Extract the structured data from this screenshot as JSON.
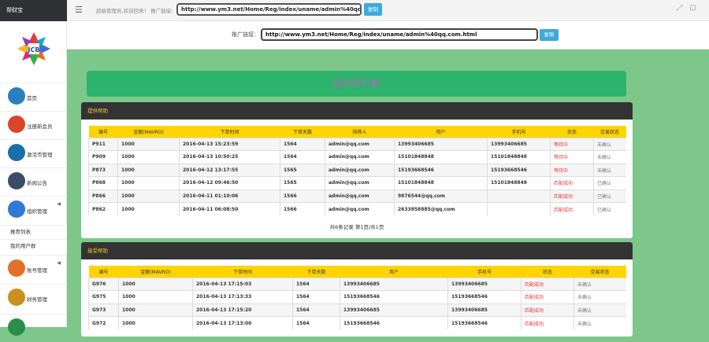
{
  "brand": "帮财宝",
  "menu_icon": "hamburger-icon",
  "welcome": "超级管理员,欢迎回来！ 推广链接：",
  "promo_url": "http://www.ym3.net/Home/Reg/index/uname/admin%40qq.com.html",
  "copy_label": "复制",
  "link_label": "推广链接：",
  "sidebar": {
    "items": [
      {
        "label": "首页",
        "icon": "home-icon",
        "color": "#2a7fc0"
      },
      {
        "label": "注册新会员",
        "icon": "lock-icon",
        "color": "#d9442a"
      },
      {
        "label": "激活币管理",
        "icon": "globe-icon",
        "color": "#1b6fa8"
      },
      {
        "label": "新闻公告",
        "icon": "satellite-icon",
        "color": "#3c4b68"
      },
      {
        "label": "组织管理",
        "icon": "puzzle-icon",
        "color": "#2d7bd5"
      }
    ],
    "sub_items": [
      "推荐列表",
      "我的用户群"
    ],
    "bottom_items": [
      {
        "label": "账号管理",
        "icon": "users-icon",
        "color": "#e0712a"
      },
      {
        "label": "财务管理",
        "icon": "dollar-icon",
        "color": "#c9901b"
      }
    ]
  },
  "banner_title": "我的用户群",
  "provide": {
    "title": "提供帮助",
    "columns": [
      "编号",
      "金额(MAVRO)",
      "下单时间",
      "下单天数",
      "排荐人",
      "用户",
      "手机号",
      "状态",
      "交易状态"
    ],
    "rows": [
      [
        "P911",
        "1000",
        "2016-04-13 15:23:59",
        "1564",
        "admin@qq.com",
        "13993406685",
        "13993406685",
        "等待中",
        "未确认"
      ],
      [
        "P909",
        "1000",
        "2016-04-13 10:50:25",
        "1564",
        "admin@qq.com",
        "15101848848",
        "15101848848",
        "等待中",
        "未确认"
      ],
      [
        "P873",
        "1000",
        "2016-04-12 13:17:55",
        "1565",
        "admin@qq.com",
        "15193668546",
        "15193668546",
        "等待中",
        "未确认"
      ],
      [
        "P868",
        "1000",
        "2016-04-12 09:46:50",
        "1565",
        "admin@qq.com",
        "15101848848",
        "15101848848",
        "匹配成功",
        "已确认"
      ],
      [
        "P866",
        "1000",
        "2016-04-11 01:10:06",
        "1566",
        "admin@qq.com",
        "9876544@qq.com",
        "",
        "匹配成功",
        "已确认"
      ],
      [
        "P862",
        "1000",
        "2016-04-11 06:08:50",
        "1566",
        "admin@qq.com",
        "2633858885@qq.com",
        "",
        "匹配成功",
        "已确认"
      ]
    ],
    "pager": "共6条记录 第1页/共1页"
  },
  "accept": {
    "title": "接受帮助",
    "columns": [
      "编号",
      "金额(MAVRO)",
      "下单时间",
      "下单天数",
      "用户",
      "手机号",
      "状态",
      "交易状态"
    ],
    "rows": [
      [
        "G976",
        "1000",
        "2016-04-13 17:15:03",
        "1564",
        "13993406685",
        "13993406685",
        "匹配成功",
        "未确认"
      ],
      [
        "G975",
        "1000",
        "2016-04-13 17:13:33",
        "1564",
        "15193668546",
        "15193668546",
        "匹配成功",
        "未确认"
      ],
      [
        "G973",
        "1000",
        "2016-04-13 17:15:20",
        "1564",
        "13993406685",
        "13993406685",
        "匹配成功",
        "未确认"
      ],
      [
        "G972",
        "1000",
        "2016-04-13 17:13:00",
        "1564",
        "15193668546",
        "15193668546",
        "匹配成功",
        "未确认"
      ]
    ]
  }
}
